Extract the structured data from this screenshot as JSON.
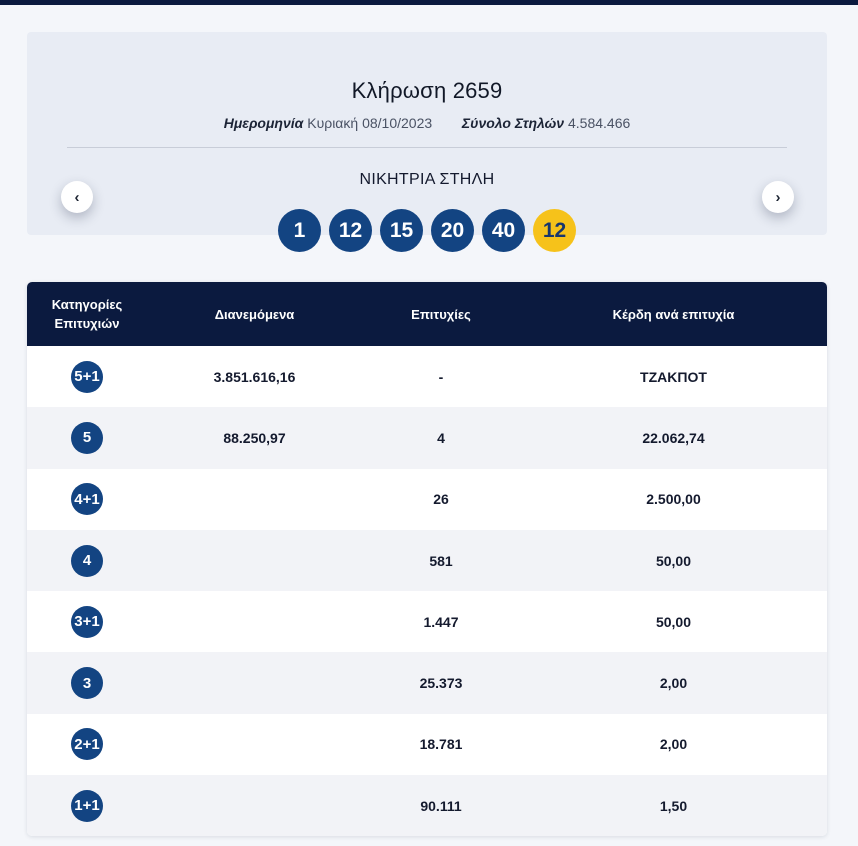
{
  "draw": {
    "title": "Κλήρωση 2659",
    "date_label": "Ημερομηνία",
    "date_value": "Κυριακή 08/10/2023",
    "total_label": "Σύνολο Στηλών",
    "total_value": "4.584.466",
    "winning_label": "ΝΙΚΗΤΡΙΑ ΣΤΗΛΗ",
    "numbers": [
      "1",
      "12",
      "15",
      "20",
      "40"
    ],
    "bonus": "12",
    "prev_icon": "chevron-left-icon",
    "next_icon": "chevron-right-icon",
    "prev_glyph": "‹",
    "next_glyph": "›"
  },
  "table": {
    "headers": [
      "Κατηγορίες Επιτυχιών",
      "Διανεμόμενα",
      "Επιτυχίες",
      "Κέρδη ανά επιτυχία"
    ],
    "rows": [
      {
        "category": "5+1",
        "distributed": "3.851.616,16",
        "winners": "-",
        "prize": "ΤΖΑΚΠΟΤ"
      },
      {
        "category": "5",
        "distributed": "88.250,97",
        "winners": "4",
        "prize": "22.062,74"
      },
      {
        "category": "4+1",
        "distributed": "",
        "winners": "26",
        "prize": "2.500,00"
      },
      {
        "category": "4",
        "distributed": "",
        "winners": "581",
        "prize": "50,00"
      },
      {
        "category": "3+1",
        "distributed": "",
        "winners": "1.447",
        "prize": "50,00"
      },
      {
        "category": "3",
        "distributed": "",
        "winners": "25.373",
        "prize": "2,00"
      },
      {
        "category": "2+1",
        "distributed": "",
        "winners": "18.781",
        "prize": "2,00"
      },
      {
        "category": "1+1",
        "distributed": "",
        "winners": "90.111",
        "prize": "1,50"
      }
    ]
  },
  "colors": {
    "header_bg": "#0b1a3f",
    "ball_blue": "#134482",
    "ball_bonus": "#f6c21a"
  }
}
